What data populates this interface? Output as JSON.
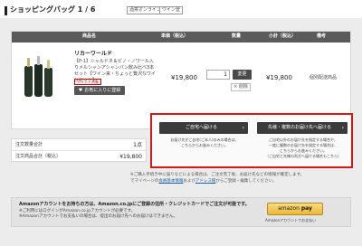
{
  "header": {
    "title": "ショッピングバッグ 1 / 6",
    "tags": [
      "酒寄オンライン",
      "ワイン登"
    ]
  },
  "cart": {
    "columns": [
      "商品名",
      "単価（税込）",
      "数量",
      "小計（税込）",
      "備考"
    ],
    "item": {
      "name": "リカーワールド",
      "description": "【P-1】シャルドネ＆ピノ・ノワール入りメルシャンアシャンパン飲み比べ3本セット【ワイン来・ちょっと贅沢なワインセット】",
      "badge": "ポイント対象",
      "favorite_label": "お気に入りに登録",
      "unit_price": "¥19,800",
      "quantity": "1",
      "change_label": "変更",
      "delete_label": "× 削除",
      "subtotal": "¥19,800",
      "note": "個別配送商品"
    }
  },
  "summary": {
    "rows": [
      {
        "label": "注文数量合計",
        "value": "1点"
      },
      {
        "label": "注文商品合計（税込）",
        "value": "¥19,800"
      }
    ]
  },
  "delivery": {
    "home_button": "ご自宅へ届ける",
    "multi_button": "先様・複数のお届け先へ届ける",
    "home_note": [
      "お届け先がご自宅(ご本人)のみの場合は、",
      "こちらからお進みください。"
    ],
    "multi_note": [
      "ご自宅以外のお届け先を指定する場合や、",
      "一度に複数のお届け先を指定する場合は、",
      "こちらからお進みください。",
      "（ご自宅と先様の両方へ届ける場合もこちら）"
    ]
  },
  "notice": {
    "line1": "※ご購入手続き中に誤りなどによる場合は、ご注文完了後、お届け先などの情報が確定します。",
    "line2_prefix": "でマイページの",
    "line2_link1": "会員基本情報",
    "line2_mid": "および",
    "line2_link2": "アドレス帳",
    "line2_suffix": "からご登録・編集してください。"
  },
  "amazon": {
    "heading": "Amazonアカウントをお持ちの方は、Amazon.co.jpにご登録の住所・クレジットカードでご注文が可能です。",
    "note_lines": [
      "※ご利用にはログインがAmazon.co.jpアカウントが必要です。",
      "※Amazonアカウントでお支払いの場合は、提出のお届け先へのお届けはできません。"
    ],
    "button_brand": "amazon",
    "button_pay": "pay",
    "button_caption": "Amazonアカウントでお支払い"
  },
  "colors": {
    "highlight_border": "#d61a1a",
    "dark_button": "#3b3b3b",
    "table_header": "#5b5b5b",
    "amazon_button": "#eab735"
  }
}
